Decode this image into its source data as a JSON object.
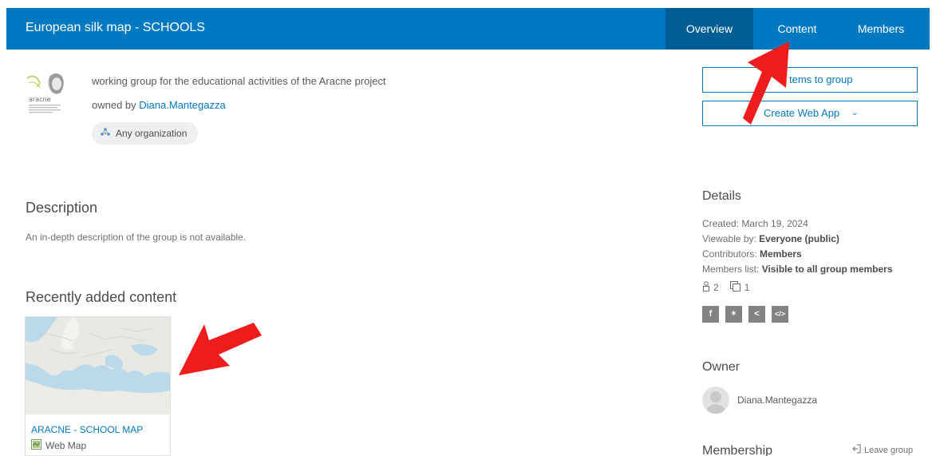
{
  "header": {
    "title": "European silk map - SCHOOLS",
    "tabs": [
      {
        "label": "Overview",
        "active": true
      },
      {
        "label": "Content",
        "active": false
      },
      {
        "label": "Members",
        "active": false
      }
    ],
    "accent_color": "#0079c1"
  },
  "group": {
    "logo_text": "aracne",
    "summary": "working group for the educational activities of the Aracne project",
    "owned_prefix": "owned by",
    "owner_name": "Diana.Mantegazza",
    "access_label": "Any organization"
  },
  "actions": {
    "add_items": "tems to group",
    "create_web_app": "Create Web App"
  },
  "description": {
    "heading": "Description",
    "text": "An in-depth description of the group is not available."
  },
  "recent": {
    "heading": "Recently added content",
    "items": [
      {
        "title": "ARACNE - SCHOOL MAP",
        "type": "Web Map"
      }
    ]
  },
  "details": {
    "heading": "Details",
    "created_label": "Created:",
    "created_value": "March 19, 2024",
    "viewable_label": "Viewable by:",
    "viewable_value": "Everyone (public)",
    "contributors_label": "Contributors:",
    "contributors_value": "Members",
    "members_list_label": "Members list:",
    "members_list_value": "Visible to all group members",
    "member_count": "2",
    "content_count": "1",
    "share_icons": [
      "facebook-icon",
      "twitter-icon",
      "share-icon",
      "embed-icon"
    ]
  },
  "owner": {
    "heading": "Owner",
    "name": "Diana.Mantegazza"
  },
  "membership": {
    "heading": "Membership",
    "leave": "Leave group"
  }
}
